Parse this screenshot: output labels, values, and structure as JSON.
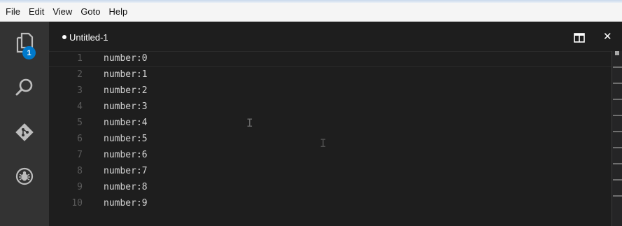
{
  "menu": [
    "File",
    "Edit",
    "View",
    "Goto",
    "Help"
  ],
  "activity_bar": {
    "items": [
      {
        "icon": "files-icon",
        "badge": "1"
      },
      {
        "icon": "search-icon"
      },
      {
        "icon": "git-icon"
      },
      {
        "icon": "debug-icon"
      }
    ]
  },
  "tab": {
    "title": "Untitled-1",
    "dirty": true
  },
  "editor": {
    "lines": [
      {
        "number": "1",
        "text": "number:0"
      },
      {
        "number": "2",
        "text": "number:1"
      },
      {
        "number": "3",
        "text": "number:2"
      },
      {
        "number": "4",
        "text": "number:3"
      },
      {
        "number": "5",
        "text": "number:4"
      },
      {
        "number": "6",
        "text": "number:5"
      },
      {
        "number": "7",
        "text": "number:6"
      },
      {
        "number": "8",
        "text": "number:7"
      },
      {
        "number": "9",
        "text": "number:8"
      },
      {
        "number": "10",
        "text": "number:9"
      }
    ]
  },
  "colors": {
    "editor_bg": "#1e1e1e",
    "activity_bar_bg": "#333333",
    "badge_bg": "#007acc",
    "text": "#d4d4d4",
    "line_number": "#5a5a5a"
  }
}
